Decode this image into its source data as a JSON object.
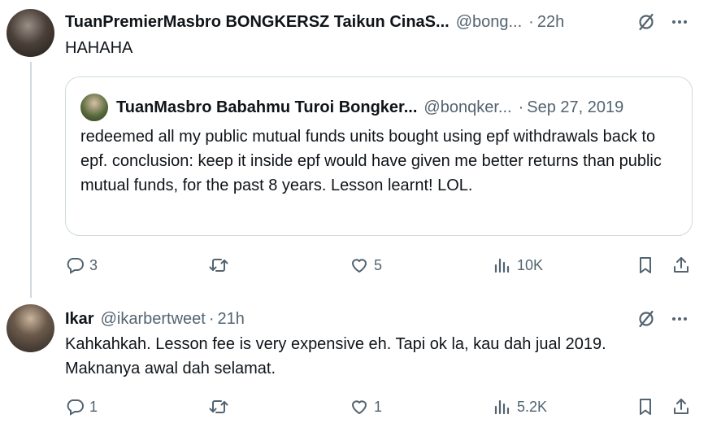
{
  "tweet1": {
    "name": "TuanPremierMasbro BONGKERSZ Taikun CinaS...",
    "handle": "@bong...",
    "dot": "·",
    "time": "22h",
    "text": "HAHAHA",
    "quote": {
      "name": "TuanMasbro Babahmu Turoi Bongker...",
      "handle": "@bonqker...",
      "dot": "·",
      "time": "Sep 27, 2019",
      "text": "redeemed all my public mutual funds units bought using epf withdrawals back to epf. conclusion: keep it inside epf would have given me better returns than public mutual funds, for the past 8 years. Lesson learnt! LOL."
    },
    "actions": {
      "replies": "3",
      "retweets": "",
      "likes": "5",
      "views": "10K"
    }
  },
  "tweet2": {
    "name": "Ikar",
    "handle": "@ikarbertweet",
    "dot": "·",
    "time": "21h",
    "text": "Kahkahkah. Lesson fee is very expensive eh. Tapi ok la, kau dah jual 2019. Maknanya awal dah selamat.",
    "actions": {
      "replies": "1",
      "retweets": "",
      "likes": "1",
      "views": "5.2K"
    }
  },
  "icons": {
    "grok": "grok-slash-icon",
    "more": "more-dots-icon",
    "reply": "reply-bubble-icon",
    "retweet": "retweet-icon",
    "like": "heart-icon",
    "views": "views-bars-icon",
    "bookmark": "bookmark-icon",
    "share": "share-upload-icon"
  },
  "colors": {
    "text": "#0f1419",
    "secondary": "#536471",
    "border": "#cfd9de"
  }
}
